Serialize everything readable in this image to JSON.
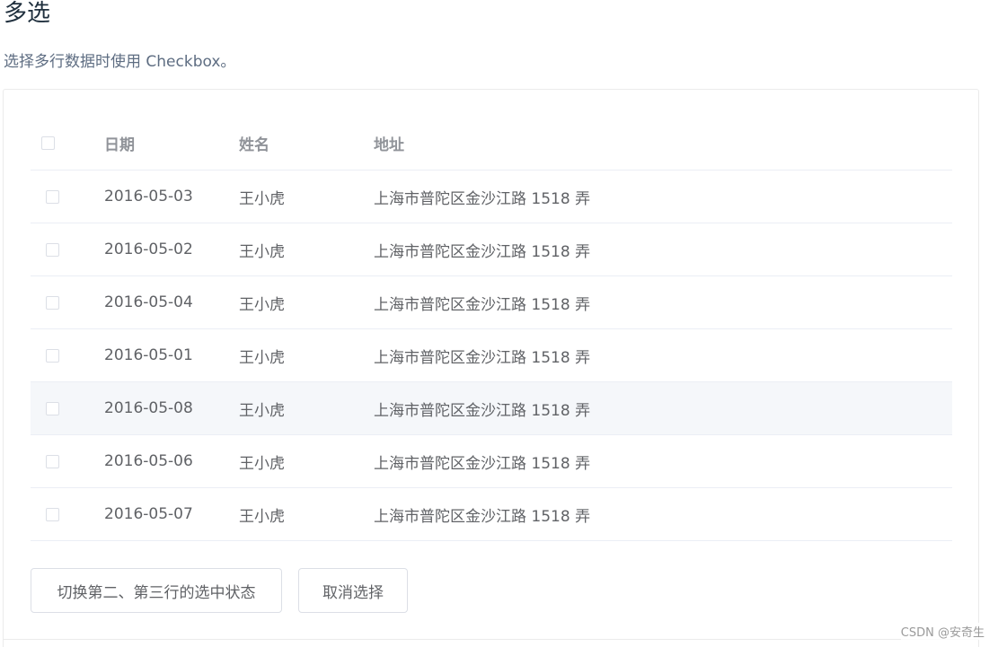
{
  "page": {
    "title": "多选",
    "description": "选择多行数据时使用 Checkbox。"
  },
  "table": {
    "columns": [
      "日期",
      "姓名",
      "地址"
    ],
    "rows": [
      {
        "date": "2016-05-03",
        "name": "王小虎",
        "address": "上海市普陀区金沙江路 1518 弄",
        "checked": false
      },
      {
        "date": "2016-05-02",
        "name": "王小虎",
        "address": "上海市普陀区金沙江路 1518 弄",
        "checked": false
      },
      {
        "date": "2016-05-04",
        "name": "王小虎",
        "address": "上海市普陀区金沙江路 1518 弄",
        "checked": false
      },
      {
        "date": "2016-05-01",
        "name": "王小虎",
        "address": "上海市普陀区金沙江路 1518 弄",
        "checked": false
      },
      {
        "date": "2016-05-08",
        "name": "王小虎",
        "address": "上海市普陀区金沙江路 1518 弄",
        "checked": false
      },
      {
        "date": "2016-05-06",
        "name": "王小虎",
        "address": "上海市普陀区金沙江路 1518 弄",
        "checked": false
      },
      {
        "date": "2016-05-07",
        "name": "王小虎",
        "address": "上海市普陀区金沙江路 1518 弄",
        "checked": false
      }
    ],
    "hovered_row_index": 4
  },
  "buttons": {
    "toggle_label": "切换第二、第三行的选中状态",
    "clear_label": "取消选择"
  },
  "watermark": "CSDN @安奇生",
  "colors": {
    "title": "#1f2f3d",
    "text": "#606266",
    "header_text": "#909399",
    "border": "#ebeef5",
    "hover_row": "#f5f7fa"
  }
}
